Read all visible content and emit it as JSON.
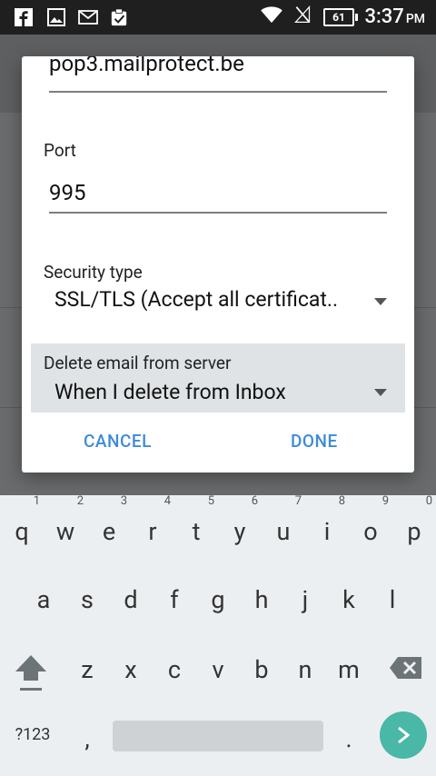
{
  "status_bar": {
    "time": "3:37",
    "ampm": "PM",
    "battery": "61",
    "icons": [
      "facebook-icon",
      "gallery-icon",
      "mail-icon",
      "clipboard-check-icon",
      "wifi-icon",
      "no-signal-icon",
      "battery-icon"
    ]
  },
  "dialog": {
    "server_value": "pop3.mailprotect.be",
    "port_label": "Port",
    "port_value": "995",
    "security_label": "Security type",
    "security_value": "SSL/TLS (Accept all certificat..",
    "delete_label": "Delete email from server",
    "delete_value": "When I delete from Inbox",
    "cancel_label": "CANCEL",
    "done_label": "DONE"
  },
  "keyboard": {
    "row1": [
      {
        "key": "q",
        "hint": "1"
      },
      {
        "key": "w",
        "hint": "2"
      },
      {
        "key": "e",
        "hint": "3"
      },
      {
        "key": "r",
        "hint": "4"
      },
      {
        "key": "t",
        "hint": "5"
      },
      {
        "key": "y",
        "hint": "6"
      },
      {
        "key": "u",
        "hint": "7"
      },
      {
        "key": "i",
        "hint": "8"
      },
      {
        "key": "o",
        "hint": "9"
      },
      {
        "key": "p",
        "hint": "0"
      }
    ],
    "row2": [
      "a",
      "s",
      "d",
      "f",
      "g",
      "h",
      "j",
      "k",
      "l"
    ],
    "row3": [
      "z",
      "x",
      "c",
      "v",
      "b",
      "n",
      "m"
    ],
    "symbols_label": "?123",
    "comma": ",",
    "period": ".",
    "colors": {
      "enter": "#49b8a6",
      "accent": "#3f8bd6"
    }
  }
}
